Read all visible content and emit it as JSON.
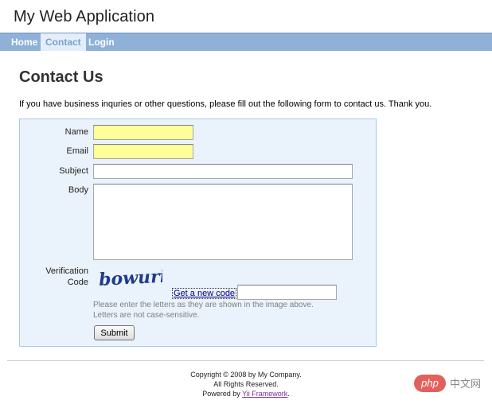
{
  "app": {
    "title": "My Web Application"
  },
  "nav": {
    "items": [
      {
        "label": "Home",
        "active": false
      },
      {
        "label": "Contact",
        "active": true
      },
      {
        "label": "Login",
        "active": false
      }
    ]
  },
  "page": {
    "title": "Contact Us",
    "intro": "If you have business inquries or other questions, please fill out the following form to contact us. Thank you."
  },
  "form": {
    "name_label": "Name",
    "email_label": "Email",
    "subject_label": "Subject",
    "body_label": "Body",
    "verification_label_line1": "Verification",
    "verification_label_line2": "Code",
    "name_value": "",
    "email_value": "",
    "subject_value": "",
    "body_value": "",
    "verification_value": "",
    "captcha_text": "bowuri",
    "new_code_link": "Get a new code",
    "hint_line1": "Please enter the letters as they are shown in the image above.",
    "hint_line2": "Letters are not case-sensitive.",
    "submit_label": "Submit"
  },
  "footer": {
    "line1": "Copyright © 2008 by My Company.",
    "line2": "All Rights Reserved.",
    "powered_prefix": "Powered by ",
    "framework_link": "Yii Framework",
    "powered_suffix": "."
  },
  "watermark": {
    "badge": "php",
    "text": "中文网"
  },
  "colors": {
    "navbar": "#8fb1d8",
    "nav_active_bg": "#e3eefb",
    "form_panel_bg": "#eaf2fb",
    "required_field_bg": "#ffff99",
    "captcha_ink": "#1f3b8c"
  }
}
